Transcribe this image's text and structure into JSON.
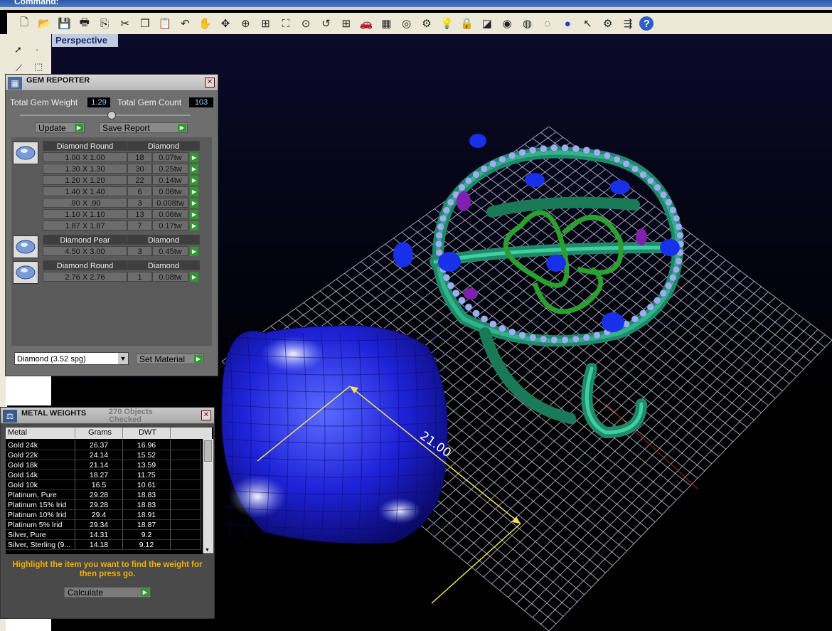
{
  "command_bar": {
    "text": "Command:"
  },
  "toolbar": {
    "icons": [
      "new-file-icon",
      "open-folder-icon",
      "save-icon",
      "print-icon",
      "import-icon",
      "cut-icon",
      "copy-icon",
      "paste-icon",
      "undo-icon",
      "pan-hand-icon",
      "rotate-view-icon",
      "zoom-icon",
      "zoom-window-icon",
      "zoom-extents-icon",
      "zoom-selected-icon",
      "undo-view-icon",
      "four-viewports-icon",
      "car-object-icon",
      "grid-plane-icon",
      "osnap-icon",
      "object-properties-icon",
      "light-bulb-icon",
      "lock-icon",
      "layer-icon",
      "color-wheel-icon",
      "wireframe-sphere-icon",
      "ghosted-sphere-icon",
      "rendered-sphere-icon",
      "pointer-icon",
      "gear-icon",
      "flow-icon",
      "help-icon"
    ]
  },
  "viewport": {
    "label": "Perspective",
    "dimension": "21.00"
  },
  "gem_reporter": {
    "title": "GEM REPORTER",
    "total_weight_label": "Total Gem Weight",
    "total_weight_value": "1.29",
    "total_count_label": "Total Gem Count",
    "total_count_value": "103",
    "update_label": "Update",
    "save_report_label": "Save Report",
    "groups": [
      {
        "shape": "Diamond Round",
        "material": "Diamond",
        "rows": [
          {
            "size": "1.00 X 1.00",
            "count": "18",
            "weight": "0.07tw"
          },
          {
            "size": "1.30 X 1.30",
            "count": "30",
            "weight": "0.25tw"
          },
          {
            "size": "1.20 X 1.20",
            "count": "22",
            "weight": "0.14tw"
          },
          {
            "size": "1.40 X 1.40",
            "count": "6",
            "weight": "0.06tw"
          },
          {
            "size": ".90 X .90",
            "count": "3",
            "weight": "0.008tw"
          },
          {
            "size": "1.10 X 1.10",
            "count": "13",
            "weight": "0.06tw"
          },
          {
            "size": "1.87 X 1.87",
            "count": "7",
            "weight": "0.17tw"
          }
        ]
      },
      {
        "shape": "Diamond Pear",
        "material": "Diamond",
        "rows": [
          {
            "size": "4.50 X 3.00",
            "count": "3",
            "weight": "0.45tw"
          }
        ]
      },
      {
        "shape": "Diamond Round",
        "material": "Diamond",
        "rows": [
          {
            "size": "2.76 X 2.76",
            "count": "1",
            "weight": "0.08tw"
          }
        ]
      }
    ],
    "material_select": "Diamond     (3.52 spg)",
    "set_material_label": "Set Material"
  },
  "metal_weights": {
    "title": "METAL WEIGHTS",
    "objects_checked": "270 Objects Checked",
    "columns": [
      "Metal",
      "Grams",
      "DWT"
    ],
    "rows": [
      [
        "Gold 24k",
        "26.37",
        "16.96"
      ],
      [
        "Gold 22k",
        "24.14",
        "15.52"
      ],
      [
        "Gold 18k",
        "21.14",
        "13.59"
      ],
      [
        "Gold 14k",
        "18.27",
        "11.75"
      ],
      [
        "Gold 10k",
        "16.5",
        "10.61"
      ],
      [
        "Platinum, Pure",
        "29.28",
        "18.83"
      ],
      [
        "Platinum 15% Irid",
        "29.28",
        "18.83"
      ],
      [
        "Platinum 10% Irid",
        "29.4",
        "18.91"
      ],
      [
        "Platinum 5% Irid",
        "29.34",
        "18.87"
      ],
      [
        "Silver, Pure",
        "14.31",
        "9.2"
      ],
      [
        "Silver, Sterling (9...",
        "14.18",
        "9.12"
      ]
    ],
    "hint": "Highlight the item you want to find the weight for then press go.",
    "calculate_label": "Calculate"
  }
}
